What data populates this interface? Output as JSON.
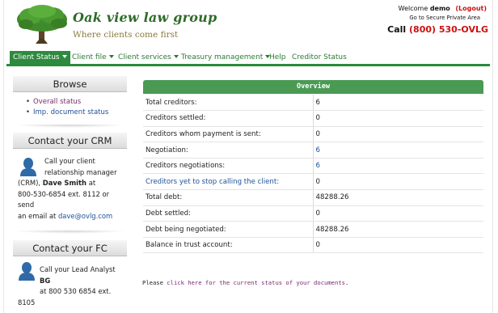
{
  "header": {
    "logo_name": "Oak view law group",
    "logo_tagline": "Where clients come first",
    "welcome_prefix": "Welcome",
    "username": "demo",
    "logout_label": "(Logout)",
    "secure_link": "Go to Secure Private Area",
    "call_label": "Call",
    "phone": "(800) 530-OVLG"
  },
  "nav": {
    "items": [
      {
        "label": "Client Status",
        "active": true,
        "dropdown": true
      },
      {
        "label": "Client file",
        "dropdown": true
      },
      {
        "label": "Client services",
        "dropdown": true
      },
      {
        "label": "Treasury management",
        "dropdown": true
      },
      {
        "label": "Help",
        "dropdown": false
      },
      {
        "label": "Creditor Status",
        "dropdown": false
      }
    ]
  },
  "sidebar": {
    "browse": {
      "title": "Browse",
      "items": [
        "Overall status",
        "Imp. document status"
      ]
    },
    "crm": {
      "title": "Contact your CRM",
      "line1": "Call your client",
      "line2": "relationship manager",
      "line3_prefix": "(CRM),",
      "name": "Dave Smith",
      "line3_suffix": " at",
      "line4": "800-530-6854 ext. 8112 or send",
      "line5_prefix": "an email at ",
      "email": "dave@ovlg.com"
    },
    "fc": {
      "title": "Contact your FC",
      "line1_prefix": "Call your Lead Analyst ",
      "analyst": "BG",
      "line2": "at 800 530 6854 ext.",
      "line3": "8105"
    }
  },
  "overview": {
    "title": "Overview",
    "rows": [
      {
        "label": "Total creditors:",
        "value": "6"
      },
      {
        "label": "Creditors settled:",
        "value": "0"
      },
      {
        "label": "Creditors whom payment is sent:",
        "value": "0"
      },
      {
        "label": "Negotiation:",
        "value": "6"
      },
      {
        "label": "Creditors negotiations:",
        "value": "6"
      },
      {
        "label": "Creditors yet to stop calling the client:",
        "value": "0"
      },
      {
        "label": "Total debt:",
        "value": "48288.26"
      },
      {
        "label": "Debt settled:",
        "value": "0"
      },
      {
        "label": "Debt being negotiated:",
        "value": "48288.26"
      },
      {
        "label": "Balance in trust account:",
        "value": "0"
      }
    ]
  },
  "footer_note": {
    "prefix": "Please ",
    "link": "click here for the current status of your documents",
    "suffix": "."
  },
  "colors": {
    "brand_green": "#2e8a3e",
    "header_green": "#4a9a54",
    "accent_red": "#cc1111",
    "link_blue": "#1f4f9a",
    "link_purple": "#7a2a6a"
  }
}
